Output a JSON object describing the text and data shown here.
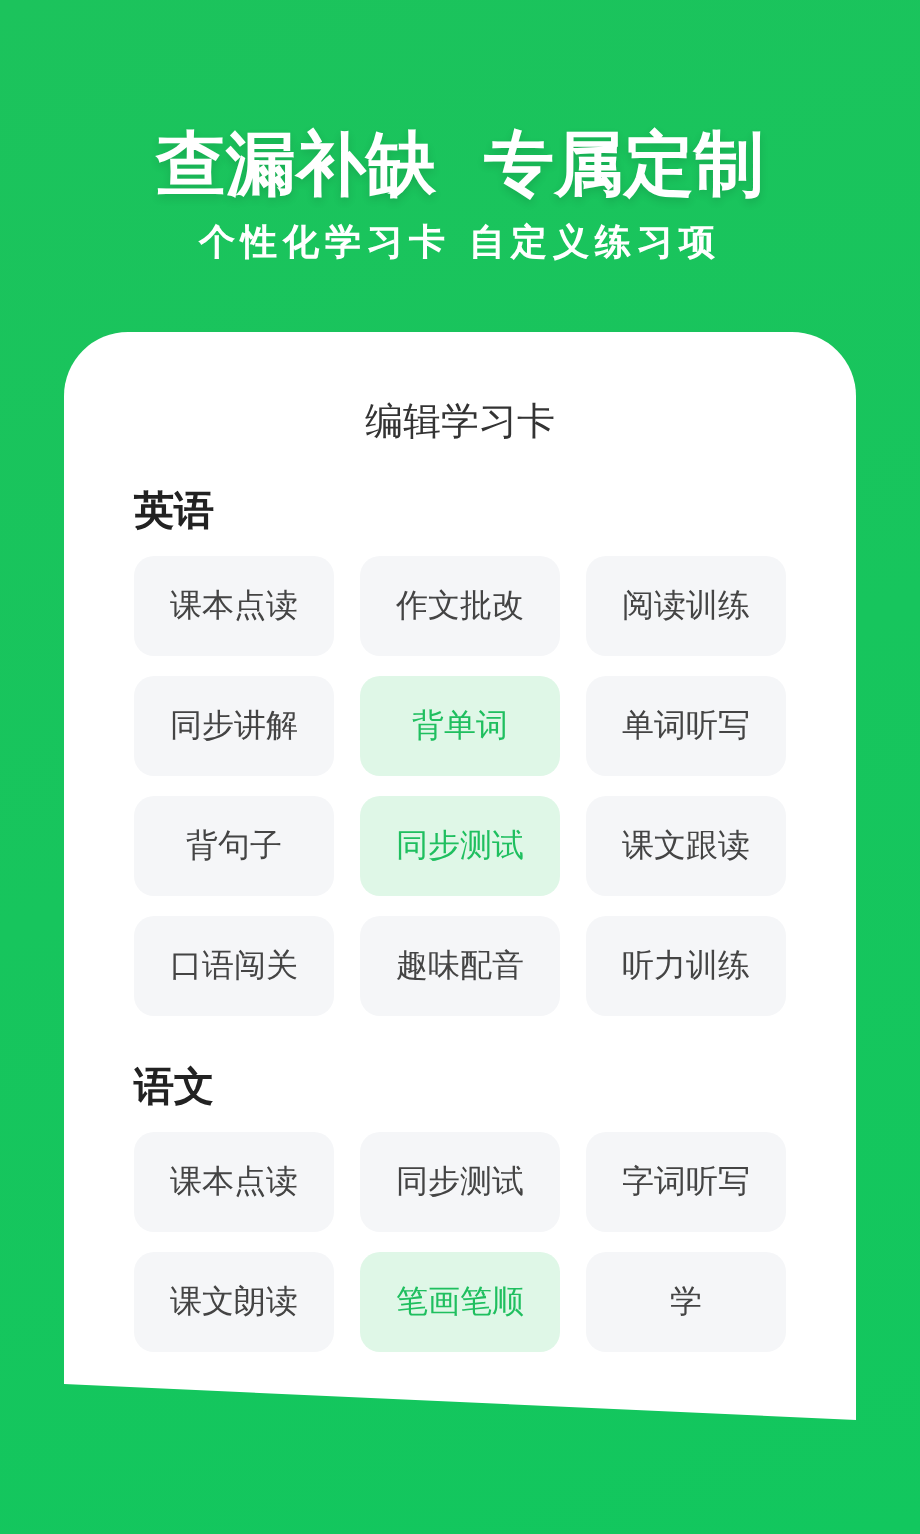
{
  "headline": "查漏补缺  专属定制",
  "subheadline": "个性化学习卡 自定义练习项",
  "card": {
    "title": "编辑学习卡",
    "sections": [
      {
        "heading": "英语",
        "items": [
          {
            "label": "课本点读",
            "selected": false
          },
          {
            "label": "作文批改",
            "selected": false
          },
          {
            "label": "阅读训练",
            "selected": false
          },
          {
            "label": "同步讲解",
            "selected": false
          },
          {
            "label": "背单词",
            "selected": true
          },
          {
            "label": "单词听写",
            "selected": false
          },
          {
            "label": "背句子",
            "selected": false
          },
          {
            "label": "同步测试",
            "selected": true
          },
          {
            "label": "课文跟读",
            "selected": false
          },
          {
            "label": "口语闯关",
            "selected": false
          },
          {
            "label": "趣味配音",
            "selected": false
          },
          {
            "label": "听力训练",
            "selected": false
          }
        ]
      },
      {
        "heading": "语文",
        "items": [
          {
            "label": "课本点读",
            "selected": false
          },
          {
            "label": "同步测试",
            "selected": false
          },
          {
            "label": "字词听写",
            "selected": false
          },
          {
            "label": "课文朗读",
            "selected": false
          },
          {
            "label": "笔画笔顺",
            "selected": true
          },
          {
            "label": "学",
            "selected": false
          }
        ]
      }
    ]
  }
}
